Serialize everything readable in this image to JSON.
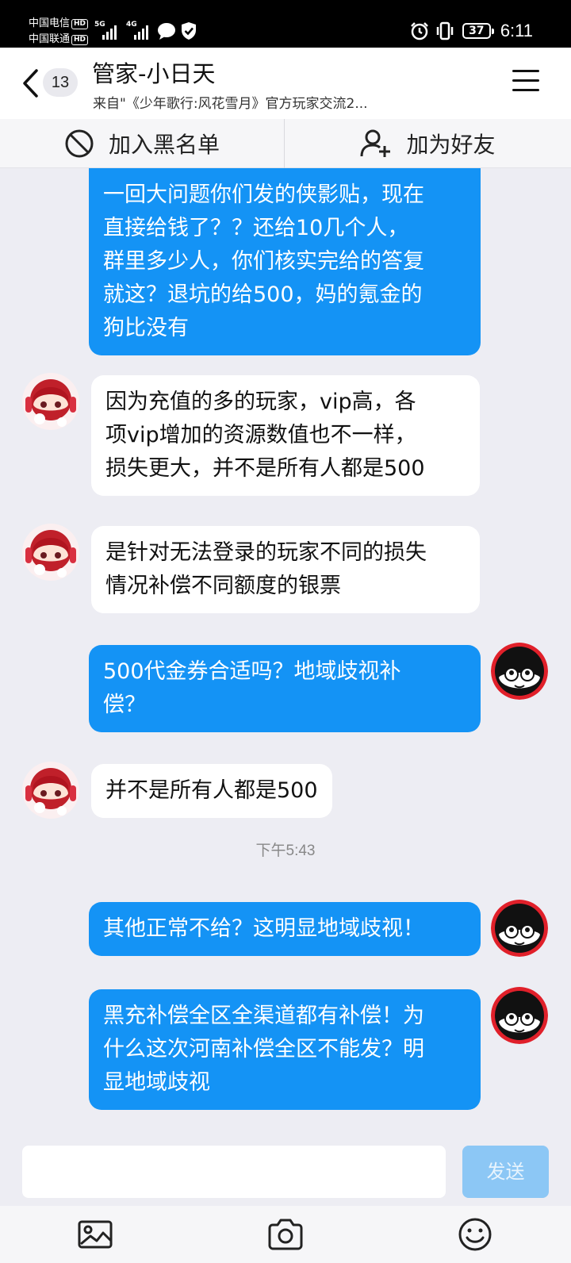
{
  "status_bar": {
    "carrier1": "中国电信",
    "carrier2": "中国联通",
    "hd": "HD",
    "net1": "5G",
    "net2": "4G",
    "battery": "37",
    "time": "6:11"
  },
  "header": {
    "unread_count": "13",
    "title": "管家-小日天",
    "subtitle": "来自\"《少年歌行:风花雪月》官方玩家交流2..."
  },
  "actions": {
    "blacklist": "加入黑名单",
    "add_friend": "加为好友"
  },
  "messages": [
    {
      "side": "out",
      "lines": [
        "一回大问题你们发的侠影贴，现在",
        "直接给钱了？？还给10几个人，",
        "群里多少人，你们核实完给的答复",
        "就这？退坑的给500，妈的氪金的",
        "狗比没有"
      ]
    },
    {
      "side": "in",
      "lines": [
        "因为充值的多的玩家，vip高，各",
        "项vip增加的资源数值也不一样，",
        "损失更大，并不是所有人都是500"
      ]
    },
    {
      "side": "in",
      "lines": [
        "是针对无法登录的玩家不同的损失",
        "情况补偿不同额度的银票"
      ]
    },
    {
      "side": "out",
      "lines": [
        "500代金券合适吗？地域歧视补",
        "偿？"
      ]
    },
    {
      "side": "in",
      "lines": [
        "并不是所有人都是500"
      ]
    },
    {
      "side": "out",
      "lines": [
        "其他正常不给？这明显地域歧视！"
      ]
    },
    {
      "side": "out",
      "lines": [
        "黑充补偿全区全渠道都有补偿！为",
        "什么这次河南补偿全区不能发？明",
        "显地域歧视"
      ]
    }
  ],
  "timestamp": "下午5:43",
  "input": {
    "placeholder": "",
    "send_label": "发送"
  },
  "toolbar": {
    "icons": [
      "image-icon",
      "camera-icon",
      "emoji-icon"
    ]
  },
  "colors": {
    "outgoing_bubble": "#1493f5",
    "incoming_bubble": "#ffffff",
    "background": "#ededf3",
    "send_disabled": "#8cc7f5"
  }
}
